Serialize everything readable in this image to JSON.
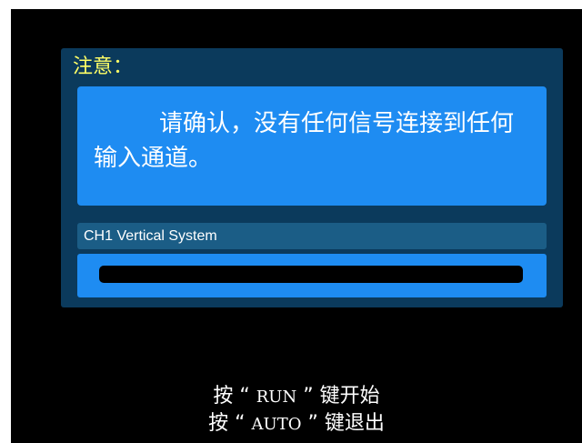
{
  "dialog": {
    "title": "注意：",
    "message": "请确认，没有任何信号连接到任何输入通道。",
    "progress_label": "CH1 Vertical System",
    "progress_fraction": 0
  },
  "hints": {
    "run_prefix": "按 “ ",
    "run_key": "RUN",
    "run_suffix": " ” 键开始",
    "auto_prefix": "按 “ ",
    "auto_key": "AUTO",
    "auto_suffix": " ” 键退出"
  },
  "colors": {
    "screen_background": "#000000",
    "dialog_background": "#0b3a5c",
    "panel_blue": "#1e8cf2",
    "title_yellow": "#ffff66",
    "text_white": "#ffffff"
  }
}
